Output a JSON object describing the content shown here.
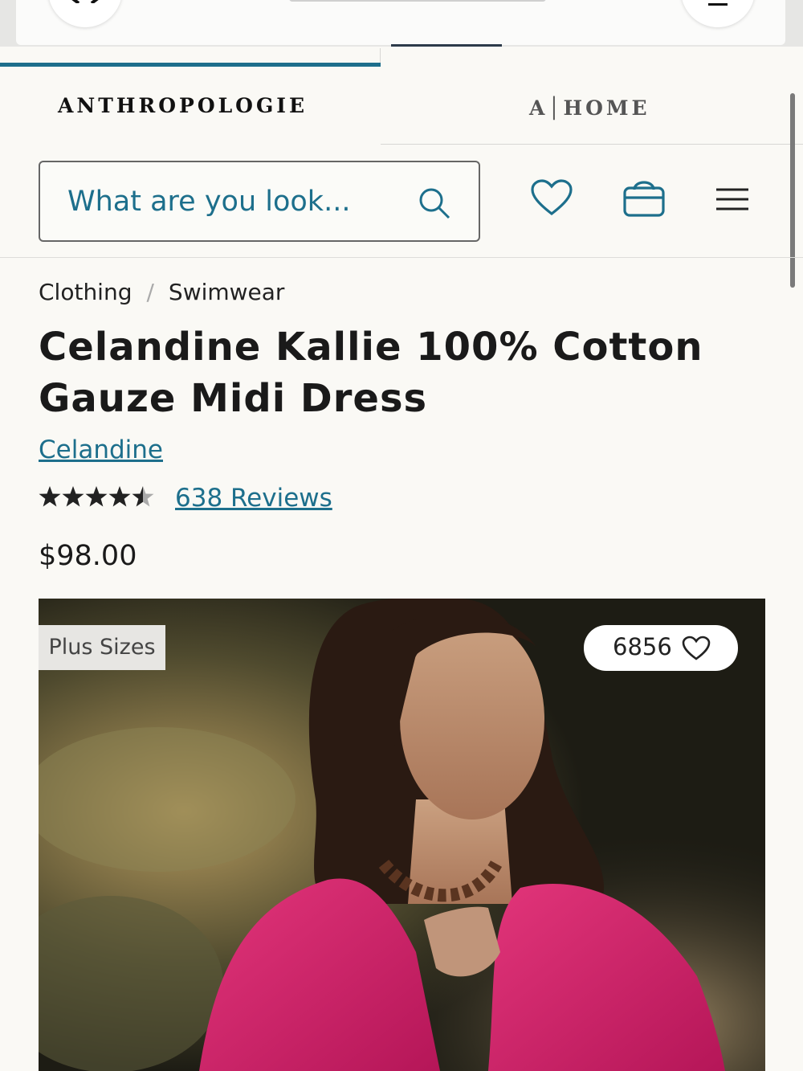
{
  "brand_tabs": {
    "anthropologie": "ANTHROPOLOGIE",
    "home": "A│HOME"
  },
  "search": {
    "placeholder": "What are you look..."
  },
  "breadcrumb": {
    "items": [
      "Clothing",
      "Swimwear"
    ],
    "separator": "/"
  },
  "product": {
    "title": "Celandine Kallie 100% Cotton Gauze Midi Dress",
    "brand": "Celandine",
    "rating": 4.5,
    "rating_max": 5,
    "stars_display": "★★★★★",
    "reviews_label": "638 Reviews",
    "price": "$98.00",
    "badge": "Plus Sizes",
    "likes": "6856"
  },
  "colors": {
    "accent": "#1d6f8c",
    "dress": "#d81b6a"
  },
  "icons": [
    "close-icon",
    "more-icon",
    "search-icon",
    "heart-icon",
    "shopping-bag-icon",
    "menu-icon"
  ]
}
